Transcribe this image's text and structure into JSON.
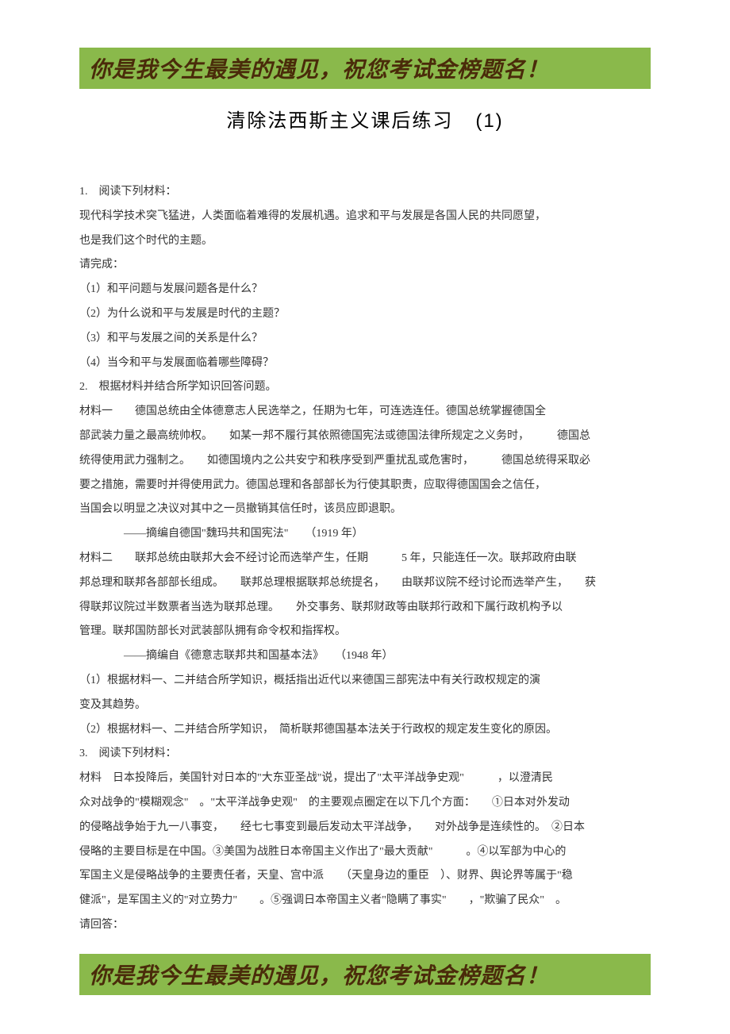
{
  "banner_text": "你是我今生最美的遇见，祝您考试金榜题名！",
  "title_main": "清除法西斯主义课后练习",
  "title_num": "(1)",
  "lines": [
    "1.　阅读下列材料：",
    "现代科学技术突飞猛进，人类面临着难得的发展机遇。追求和平与发展是各国人民的共同愿望，",
    "也是我们这个时代的主题。",
    "请完成：",
    "（1）和平问题与发展问题各是什么？",
    "（2）为什么说和平与发展是时代的主题？",
    "（3）和平与发展之间的关系是什么？",
    "（4）当今和平与发展面临着哪些障碍？",
    "2.　根据材料并结合所学知识回答问题。",
    "材料一　　德国总统由全体德意志人民选举之，任期为七年，可连选连任。德国总统掌握德国全",
    "部武装力量之最高统帅权。　　如某一邦不履行其依照德国宪法或德国法律所规定之义务时，　　　德国总",
    "统得使用武力强制之。　　如德国境内之公共安宁和秩序受到严重扰乱或危害时，　　　德国总统得采取必",
    "要之措施，需要时并得使用武力。德国总理和各部部长为行使其职责，应取得德国国会之信任，",
    "当国会以明显之决议对其中之一员撤销其信任时，该员应即退职。",
    "　　——摘编自德国\"魏玛共和国宪法\"　　（1919 年）",
    "材料二　　联邦总统由联邦大会不经讨论而选举产生，任期　　　5 年，只能连任一次。联邦政府由联",
    "邦总理和联邦各部部长组成。　　联邦总理根据联邦总统提名，　　由联邦议院不经讨论而选举产生，　　获",
    "得联邦议院过半数票者当选为联邦总理。　　外交事务、联邦财政等由联邦行政和下属行政机构予以",
    "管理。联邦国防部长对武装部队拥有命令权和指挥权。",
    "　　——摘编自《德意志联邦共和国基本法》　　（1948 年）",
    "（1）根据材料一、二并结合所学知识，概括指出近代以来德国三部宪法中有关行政权规定的演",
    "变及其趋势。",
    "（2）根据材料一、二并结合所学知识，　简析联邦德国基本法关于行政权的规定发生变化的原因。",
    "3.　阅读下列材料：",
    "材料　日本投降后，美国针对日本的\"大东亚圣战\"说，提出了\"太平洋战争史观\"　　　，以澄清民",
    "众对战争的\"模糊观念\"　。\"太平洋战争史观\"　的主要观点圈定在以下几个方面：　　①日本对外发动",
    "的侵略战争始于九一八事变，　　经七七事变到最后发动太平洋战争，　　对外战争是连续性的。　②日本",
    "侵略的主要目标是在中国。③美国为战胜日本帝国主义作出了\"最大贡献\"　　　。④以军部为中心的",
    "军国主义是侵略战争的主要责任者，天皇、宫中派　　（天皇身边的重臣　）、财界、舆论界等属于\"稳",
    "健派\"，是军国主义的\"对立势力\"　　。⑤强调日本帝国主义者\"隐瞒了事实\"　　，\"欺骗了民众\"　。",
    "请回答："
  ]
}
